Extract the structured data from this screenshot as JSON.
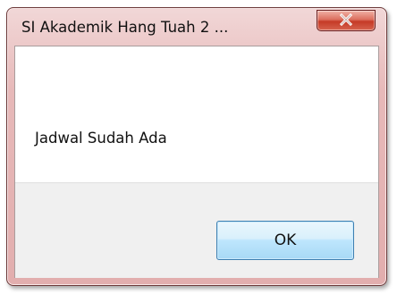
{
  "dialog": {
    "title": "SI Akademik Hang Tuah 2 ...",
    "message": "Jadwal Sudah Ada",
    "ok_label": "OK",
    "close_icon": "close-icon"
  }
}
